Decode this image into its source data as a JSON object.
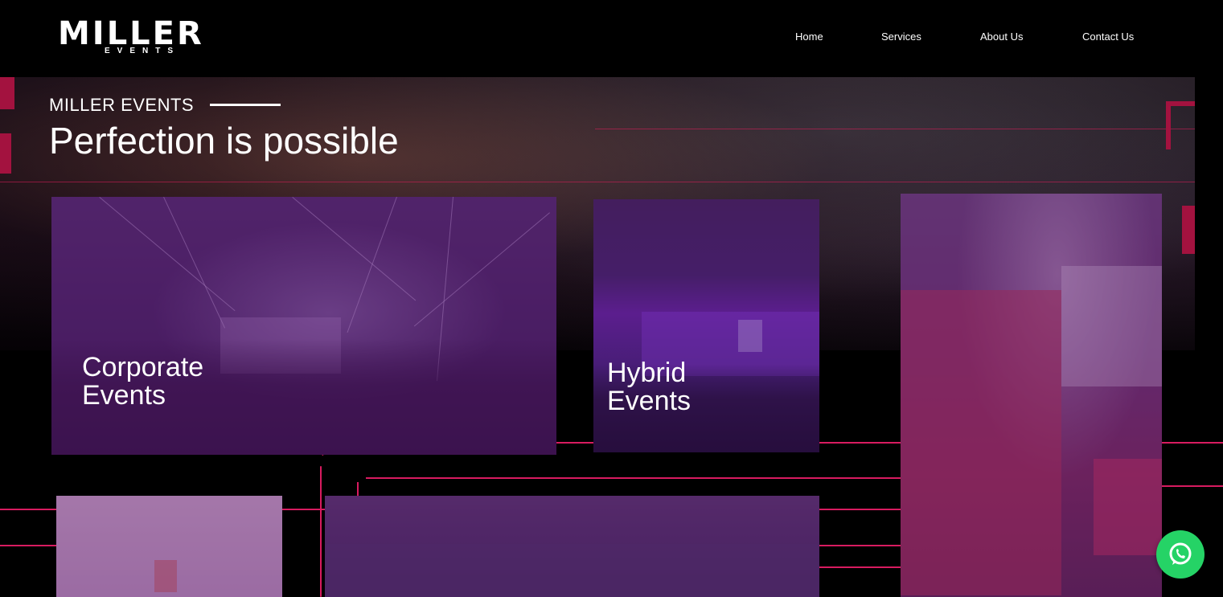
{
  "header": {
    "logo_main": "MILLER",
    "logo_sub": "EVENTS",
    "nav": [
      {
        "label": "Home"
      },
      {
        "label": "Services"
      },
      {
        "label": "About Us"
      },
      {
        "label": "Contact Us"
      }
    ]
  },
  "hero": {
    "kicker": "MILLER EVENTS",
    "title": "Perfection is possible"
  },
  "cards": {
    "corporate": {
      "label": "Corporate\nEvents"
    },
    "hybrid": {
      "label": "Hybrid\nEvents"
    }
  },
  "colors": {
    "accent": "#d81b60",
    "overlay": "#64207a",
    "whatsapp": "#25d366"
  },
  "icons": {
    "whatsapp": "whatsapp-icon"
  }
}
